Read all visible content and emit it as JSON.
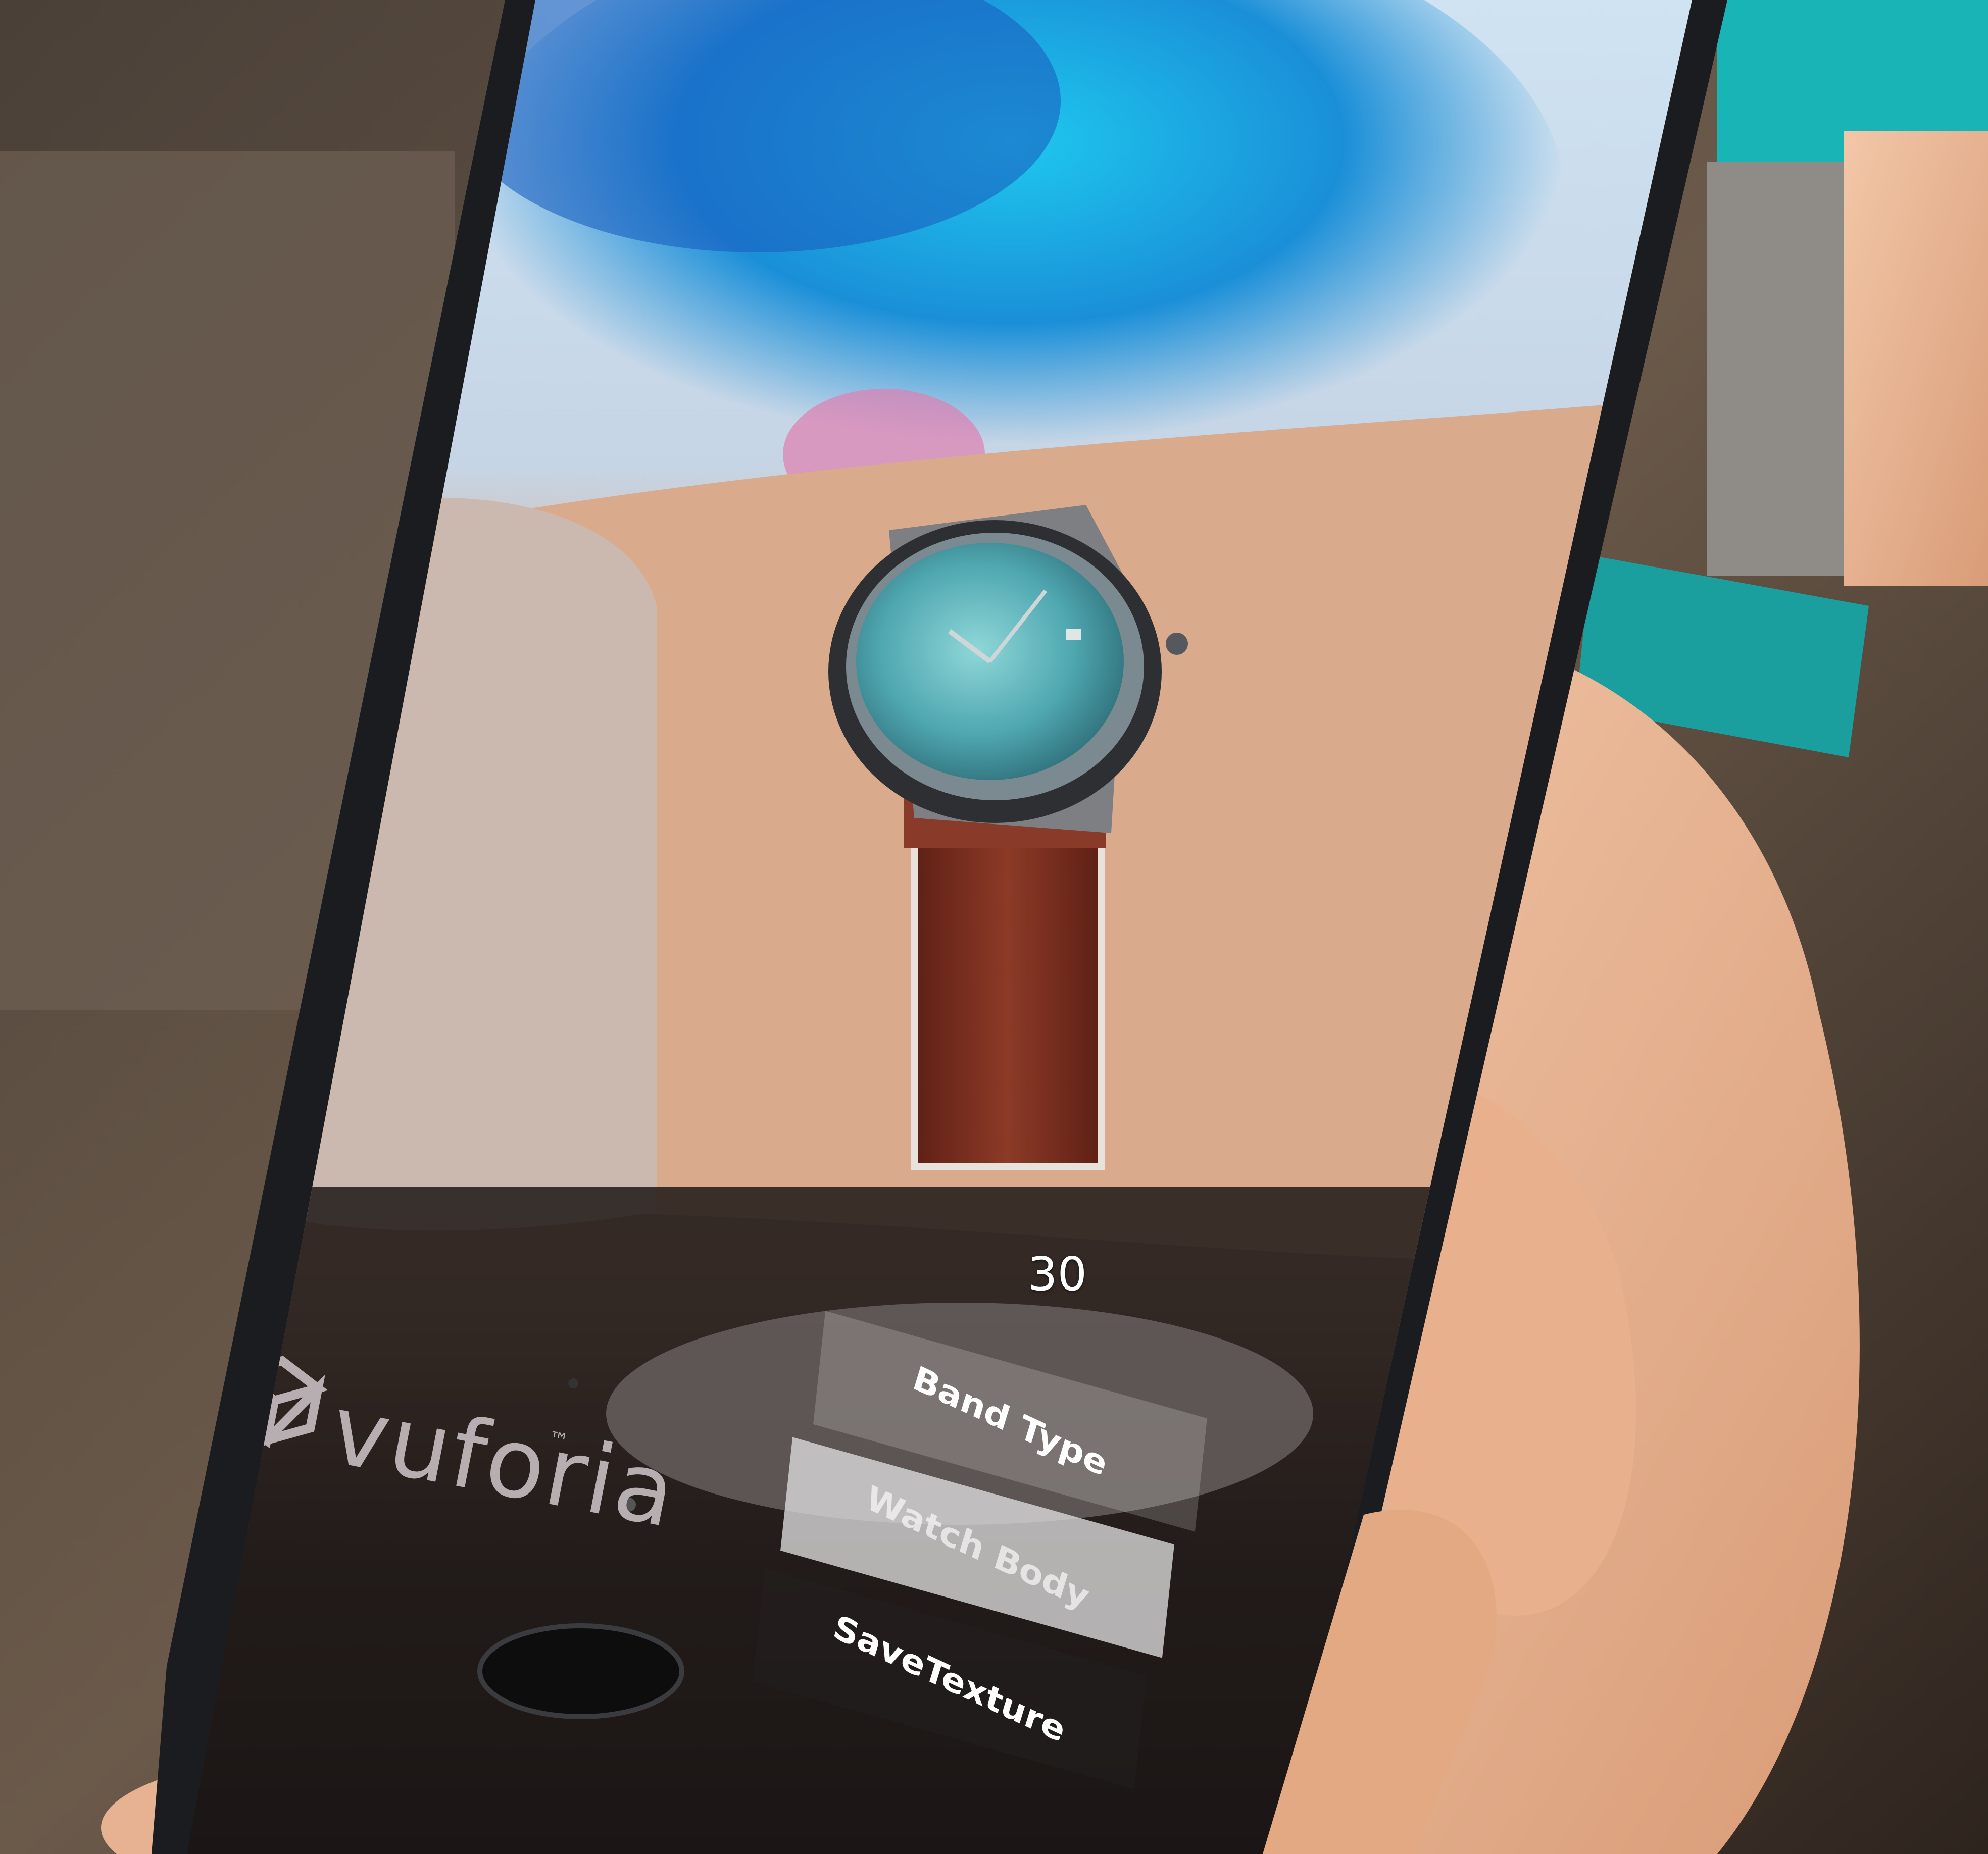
{
  "ar_overlay": {
    "fps_counter": "30",
    "brand": "vuforia",
    "brand_mark": "™",
    "menu": {
      "band_type": "Band Type",
      "watch_body": "Watch Body",
      "save_texture": "SaveTexture"
    }
  },
  "colors": {
    "watch_strap": "#7a2e1f",
    "watch_dial": "#4fa7b0",
    "smoke_blue": "#1ea6e6"
  }
}
